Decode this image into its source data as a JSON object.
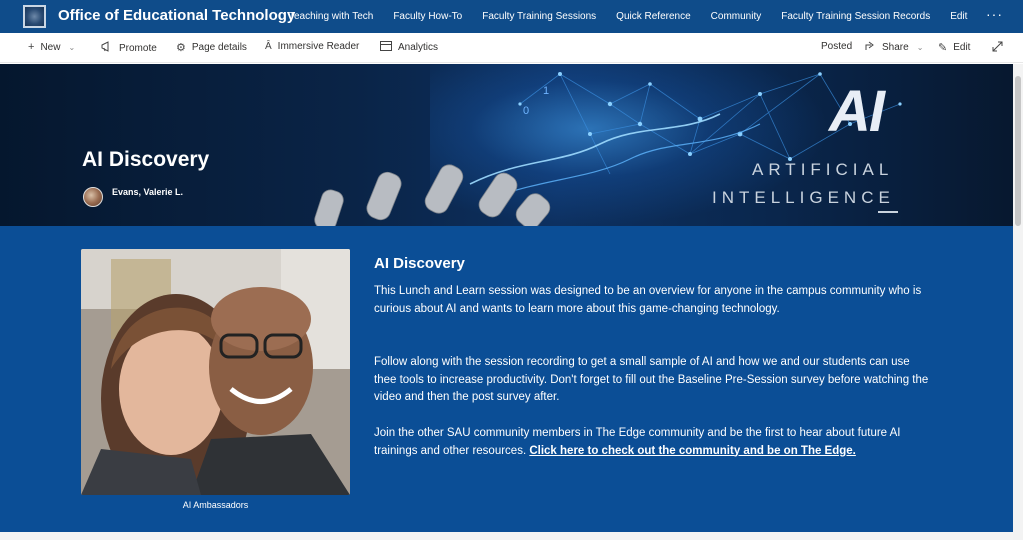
{
  "site": {
    "title": "Office of Educational Technology",
    "nav": [
      "Teaching with Tech",
      "Faculty How-To",
      "Faculty Training Sessions",
      "Quick Reference",
      "Community",
      "Faculty Training Session Records",
      "Edit"
    ],
    "more": "···"
  },
  "commandbar": {
    "new_label": "New",
    "promote_label": "Promote",
    "page_details_label": "Page details",
    "immersive_reader_label": "Immersive Reader",
    "analytics_label": "Analytics",
    "posted_label": "Posted",
    "share_label": "Share",
    "edit_label": "Edit",
    "icons": {
      "new": "plus-icon",
      "promote": "megaphone-icon",
      "page_details": "gear-icon",
      "immersive_reader": "immersive-reader-icon",
      "analytics": "analytics-icon",
      "share": "share-icon",
      "edit": "pencil-icon",
      "expand": "expand-icon"
    }
  },
  "hero": {
    "title": "AI Discovery",
    "author": "Evans, Valerie L.",
    "image_text": {
      "ai": "AI",
      "artificial": "ARTIFICIAL",
      "intelligence": "INTELLIGENCE",
      "digit_one": "1",
      "digit_zero": "0"
    }
  },
  "content": {
    "photo_caption": "AI Ambassadors",
    "title": "AI Discovery",
    "paragraph1": "This Lunch and Learn session was designed to be an overview for anyone in the campus community who is curious about AI and wants to learn more about this game-changing technology.",
    "paragraph2": "Follow along with the session recording to get a small sample of AI and how we and our students can use thee tools to increase productivity. Don't forget to fill out the Baseline Pre-Session survey before watching the video and then the post survey after.",
    "paragraph3_text": "Join the other SAU community members in The Edge community and be the first to hear about future AI trainings and other resources. ",
    "paragraph3_link": "Click here to check out the community and be on The Edge."
  },
  "colors": {
    "suite_bar": "#0f4c8a",
    "content_bg": "#0b4e96",
    "hero_bg": "#0a2447",
    "text_on_dark": "#ffffff"
  }
}
